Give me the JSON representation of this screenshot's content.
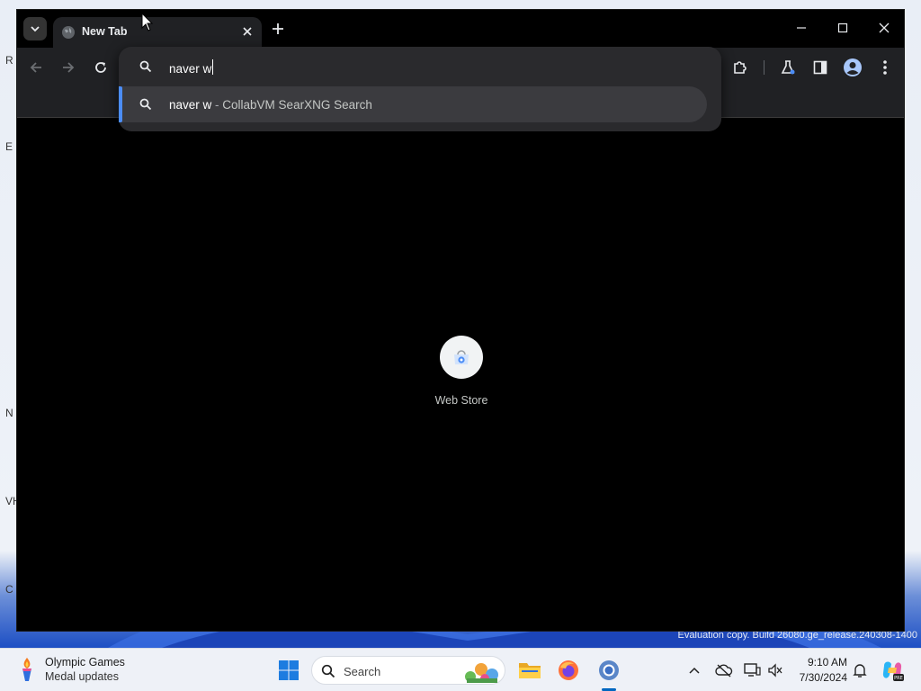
{
  "browser": {
    "tab": {
      "title": "New Tab"
    },
    "omnibox": {
      "value": "naver w",
      "suggestion": {
        "query": "naver w",
        "separator": " - ",
        "engine": "CollabVM SearXNG Search"
      }
    },
    "shortcut": {
      "label": "Web Store"
    }
  },
  "desktop": {
    "watermark": "Evaluation copy. Build 26080.ge_release.240308-1400",
    "edge_glyphs": [
      "R",
      "E",
      "N",
      "VH",
      "C"
    ]
  },
  "taskbar": {
    "widget": {
      "title": "Olympic Games",
      "subtitle": "Medal updates"
    },
    "search_placeholder": "Search",
    "clock": {
      "time": "9:10 AM",
      "date": "7/30/2024"
    }
  },
  "colors": {
    "accent": "#4c8df6",
    "window_bg": "#000000",
    "toolbar_bg": "#202124",
    "taskbar_bg": "#eef1f7"
  }
}
